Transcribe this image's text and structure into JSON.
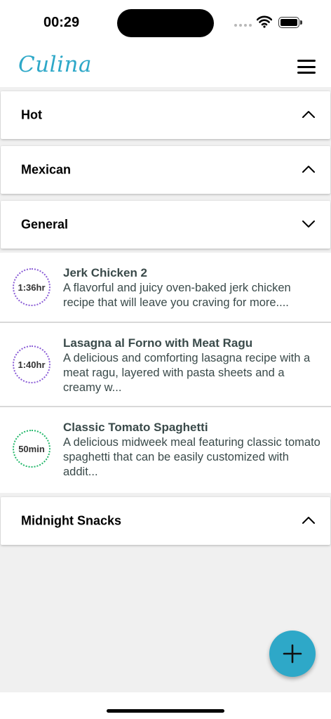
{
  "status_bar": {
    "time": "00:29"
  },
  "header": {
    "logo": "Culina"
  },
  "sections": [
    {
      "title": "Hot",
      "state": "collapsed"
    },
    {
      "title": "Mexican",
      "state": "collapsed"
    },
    {
      "title": "General",
      "state": "expanded"
    },
    {
      "title": "Midnight Snacks",
      "state": "collapsed"
    }
  ],
  "recipes": [
    {
      "time": "1:36hr",
      "title": "Jerk Chicken 2",
      "description": "A flavorful and juicy oven-baked jerk chicken recipe that will leave you craving for more....",
      "ring_color": "#8a5cd6"
    },
    {
      "time": "1:40hr",
      "title": "Lasagna al Forno with Meat Ragu",
      "description": "A delicious and comforting lasagna recipe with a meat ragu, layered with pasta sheets and a creamy w...",
      "ring_color": "#8a5cd6"
    },
    {
      "time": "50min",
      "title": "Classic Tomato Spaghetti",
      "description": "A delicious midweek meal featuring classic tomato spaghetti that can be easily customized with addit...",
      "ring_color": "#22b86a"
    }
  ],
  "fab": {
    "icon": "plus-icon"
  },
  "colors": {
    "accent": "#2ea8c8"
  }
}
